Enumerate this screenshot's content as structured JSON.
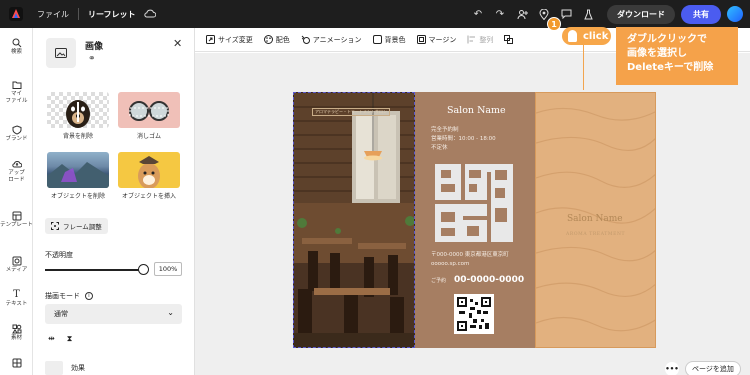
{
  "topbar": {
    "file_menu": "ファイル",
    "doc_name": "リーフレット",
    "download": "ダウンロード",
    "share": "共有"
  },
  "rail": [
    {
      "label": "検索",
      "icon": "search-icon"
    },
    {
      "label": "マイ\nファイル",
      "icon": "folder-icon"
    },
    {
      "label": "ブランド",
      "icon": "brand-shield-icon"
    },
    {
      "label": "アップ\nロード",
      "icon": "upload-cloud-icon"
    },
    {
      "label": "テンプレート",
      "icon": "template-icon"
    },
    {
      "label": "メディア",
      "icon": "media-icon"
    },
    {
      "label": "テキスト",
      "icon": "text-icon"
    },
    {
      "label": "素材",
      "icon": "elements-icon"
    },
    {
      "label": "",
      "icon": "grid-icon"
    }
  ],
  "panel": {
    "title": "画像",
    "quick_actions": [
      {
        "label": "背景を削除"
      },
      {
        "label": "消しゴム"
      },
      {
        "label": "オブジェクトを削除"
      },
      {
        "label": "オブジェクトを挿入"
      }
    ],
    "frame_adjust": "フレーム調整",
    "opacity_label": "不透明度",
    "opacity_value": "100%",
    "opacity": 1.0,
    "blend_label": "描画モード",
    "blend_value": "通常",
    "effects_label": "効果"
  },
  "toolbar": {
    "resize": "サイズ変更",
    "color": "配色",
    "animation": "アニメーション",
    "bgcolor": "背景色",
    "margin": "マージン",
    "align": "整列"
  },
  "annotation": {
    "step": "1",
    "click": "click",
    "callout_lines": [
      "ダブルクリックで",
      "画像を選択し",
      "Deleteキーで削除"
    ]
  },
  "leaflet": {
    "caption": "アロマテラピー・トリートメントサロン",
    "salon_name": "Salon Name",
    "info_lines": [
      "完全予約制",
      "営業時間：10:00 - 18:00",
      "不定休"
    ],
    "address_lines": [
      "〒000-0000 東京都港区東京町",
      "ooooo.sp.com"
    ],
    "phone_label": "ご予約",
    "phone": "00-0000-0000",
    "right_name": "Salon Name",
    "right_sub": "AROMA TREATMENT"
  },
  "bottom": {
    "more": "•••",
    "add_page": "ページを追加"
  },
  "colors": {
    "accent_orange": "#f5a24a",
    "share_blue": "#4b5cf0",
    "leaflet_brown": "#a67e62",
    "sand": "#e0b07e"
  }
}
